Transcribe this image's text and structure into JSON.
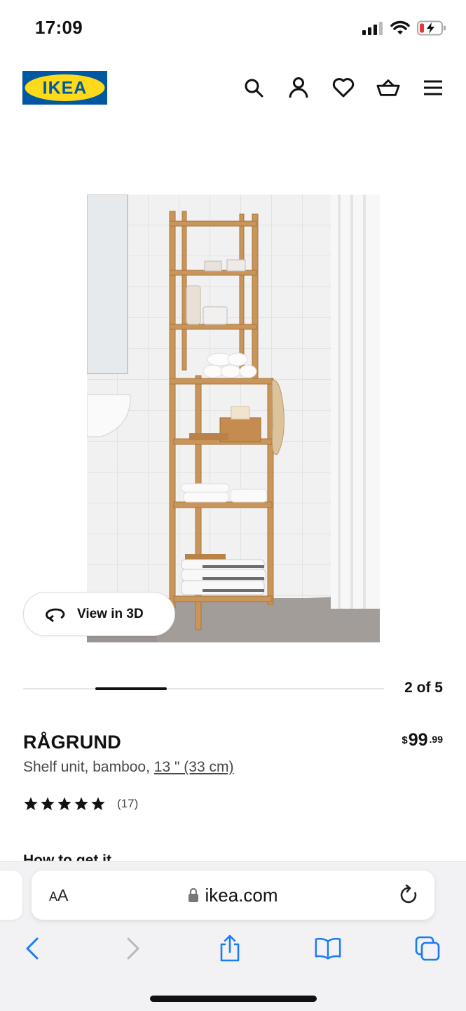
{
  "status": {
    "time": "17:09"
  },
  "header": {
    "logo_text": "IKEA",
    "icons": [
      "search-icon",
      "account-icon",
      "heart-icon",
      "basket-icon",
      "menu-icon"
    ]
  },
  "gallery": {
    "view3d_label": "View in 3D",
    "counter": "2 of 5",
    "current_index": 2,
    "total": 5
  },
  "product": {
    "name": "RÅGRUND",
    "desc_prefix": "Shelf unit, bamboo, ",
    "size_link": "13 \" (33 cm)",
    "price_currency": "$",
    "price_int": "99",
    "price_dec": ".99",
    "rating_stars": 5,
    "rating_count": "(17)"
  },
  "next_section": {
    "title": "How to get it"
  },
  "safari": {
    "aa_label_small": "A",
    "aa_label_big": "A",
    "url": "ikea.com"
  },
  "colors": {
    "ikea_blue": "#0058A3",
    "ikea_yellow": "#FFDA1A",
    "ios_blue": "#1a7cf5",
    "bamboo": "#c9955a"
  }
}
